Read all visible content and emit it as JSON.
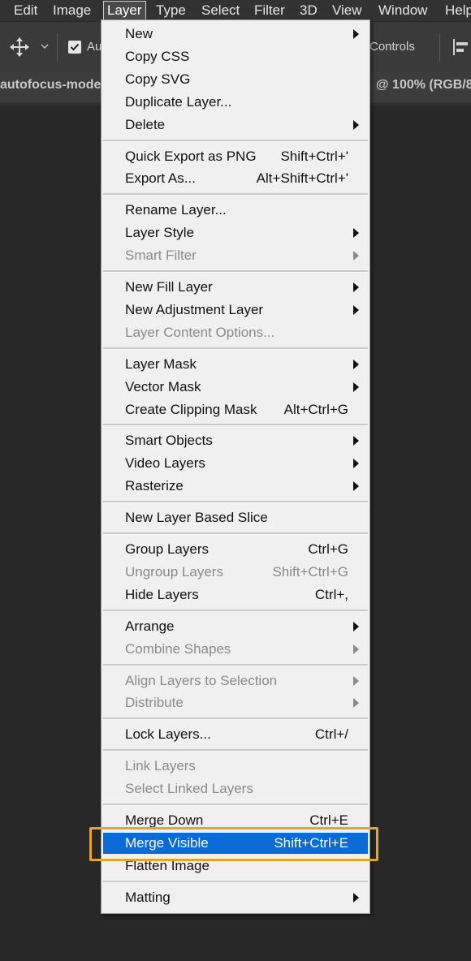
{
  "menubar": {
    "items": [
      "Edit",
      "Image",
      "Layer",
      "Type",
      "Select",
      "Filter",
      "3D",
      "View",
      "Window",
      "Help"
    ],
    "active": "Layer"
  },
  "options_bar": {
    "move_tool_icon": "move-arrows-icon",
    "auto_select_label": "Au",
    "auto_select_checked": true,
    "controls_label": "Controls",
    "align_icon": "align-left-icon"
  },
  "document_tab": {
    "name": "autofocus-mode",
    "zoom": "@ 100% (RGB/8"
  },
  "layer_menu": {
    "items": [
      {
        "label": "New",
        "shortcut": "",
        "submenu": true,
        "enabled": true
      },
      {
        "label": "Copy CSS",
        "shortcut": "",
        "submenu": false,
        "enabled": true
      },
      {
        "label": "Copy SVG",
        "shortcut": "",
        "submenu": false,
        "enabled": true
      },
      {
        "label": "Duplicate Layer...",
        "shortcut": "",
        "submenu": false,
        "enabled": true
      },
      {
        "label": "Delete",
        "shortcut": "",
        "submenu": true,
        "enabled": true
      },
      {
        "separator": true
      },
      {
        "label": "Quick Export as PNG",
        "shortcut": "Shift+Ctrl+'",
        "submenu": false,
        "enabled": true
      },
      {
        "label": "Export As...",
        "shortcut": "Alt+Shift+Ctrl+'",
        "submenu": false,
        "enabled": true
      },
      {
        "separator": true
      },
      {
        "label": "Rename Layer...",
        "shortcut": "",
        "submenu": false,
        "enabled": true
      },
      {
        "label": "Layer Style",
        "shortcut": "",
        "submenu": true,
        "enabled": true
      },
      {
        "label": "Smart Filter",
        "shortcut": "",
        "submenu": true,
        "enabled": false
      },
      {
        "separator": true
      },
      {
        "label": "New Fill Layer",
        "shortcut": "",
        "submenu": true,
        "enabled": true
      },
      {
        "label": "New Adjustment Layer",
        "shortcut": "",
        "submenu": true,
        "enabled": true
      },
      {
        "label": "Layer Content Options...",
        "shortcut": "",
        "submenu": false,
        "enabled": false
      },
      {
        "separator": true
      },
      {
        "label": "Layer Mask",
        "shortcut": "",
        "submenu": true,
        "enabled": true
      },
      {
        "label": "Vector Mask",
        "shortcut": "",
        "submenu": true,
        "enabled": true
      },
      {
        "label": "Create Clipping Mask",
        "shortcut": "Alt+Ctrl+G",
        "submenu": false,
        "enabled": true
      },
      {
        "separator": true
      },
      {
        "label": "Smart Objects",
        "shortcut": "",
        "submenu": true,
        "enabled": true
      },
      {
        "label": "Video Layers",
        "shortcut": "",
        "submenu": true,
        "enabled": true
      },
      {
        "label": "Rasterize",
        "shortcut": "",
        "submenu": true,
        "enabled": true
      },
      {
        "separator": true
      },
      {
        "label": "New Layer Based Slice",
        "shortcut": "",
        "submenu": false,
        "enabled": true
      },
      {
        "separator": true
      },
      {
        "label": "Group Layers",
        "shortcut": "Ctrl+G",
        "submenu": false,
        "enabled": true
      },
      {
        "label": "Ungroup Layers",
        "shortcut": "Shift+Ctrl+G",
        "submenu": false,
        "enabled": false
      },
      {
        "label": "Hide Layers",
        "shortcut": "Ctrl+,",
        "submenu": false,
        "enabled": true
      },
      {
        "separator": true
      },
      {
        "label": "Arrange",
        "shortcut": "",
        "submenu": true,
        "enabled": true
      },
      {
        "label": "Combine Shapes",
        "shortcut": "",
        "submenu": true,
        "enabled": false
      },
      {
        "separator": true
      },
      {
        "label": "Align Layers to Selection",
        "shortcut": "",
        "submenu": true,
        "enabled": false
      },
      {
        "label": "Distribute",
        "shortcut": "",
        "submenu": true,
        "enabled": false
      },
      {
        "separator": true
      },
      {
        "label": "Lock Layers...",
        "shortcut": "Ctrl+/",
        "submenu": false,
        "enabled": true
      },
      {
        "separator": true
      },
      {
        "label": "Link Layers",
        "shortcut": "",
        "submenu": false,
        "enabled": false
      },
      {
        "label": "Select Linked Layers",
        "shortcut": "",
        "submenu": false,
        "enabled": false
      },
      {
        "separator": true
      },
      {
        "label": "Merge Down",
        "shortcut": "Ctrl+E",
        "submenu": false,
        "enabled": true
      },
      {
        "label": "Merge Visible",
        "shortcut": "Shift+Ctrl+E",
        "submenu": false,
        "enabled": true,
        "highlighted": true
      },
      {
        "label": "Flatten Image",
        "shortcut": "",
        "submenu": false,
        "enabled": true
      },
      {
        "separator": true
      },
      {
        "label": "Matting",
        "shortcut": "",
        "submenu": true,
        "enabled": true
      }
    ]
  },
  "colors": {
    "highlight": "#0a6bd6",
    "callout": "#e2a530",
    "menu_bg": "#f0f0f0",
    "disabled_text": "#8a8a8a"
  }
}
